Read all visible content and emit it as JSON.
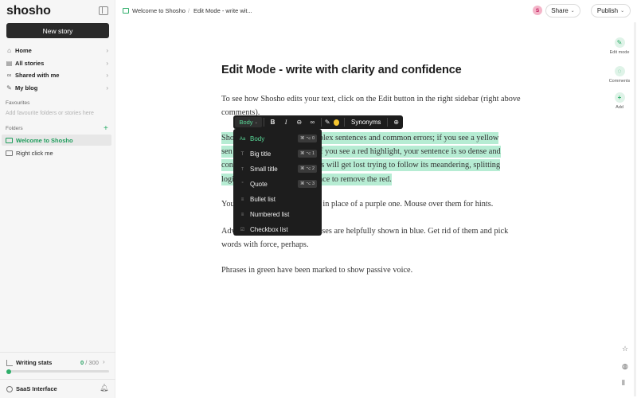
{
  "sidebar": {
    "logo": "shosho",
    "new_story": "New story",
    "nav": [
      {
        "label": "Home",
        "icon": "home-icon"
      },
      {
        "label": "All stories",
        "icon": "stories-icon"
      },
      {
        "label": "Shared with me",
        "icon": "link-icon"
      },
      {
        "label": "My blog",
        "icon": "pen-icon"
      }
    ],
    "favourites_label": "Favourites",
    "favourites_placeholder": "Add favourite folders or stories here",
    "folders_label": "Folders",
    "folders": [
      {
        "label": "Welcome to Shosho",
        "active": true
      },
      {
        "label": "Right click me",
        "active": false
      }
    ],
    "stats": {
      "label": "Writing stats",
      "count": "0",
      "total": "/ 300",
      "progress": 0.0
    },
    "workspace": "SaaS Interface"
  },
  "topbar": {
    "breadcrumb": [
      "Welcome to Shosho",
      "Edit Mode - write wit..."
    ],
    "avatar_letter": "S",
    "share_label": "Share",
    "publish_label": "Publish"
  },
  "rail": [
    {
      "label": "Edit mode",
      "icon": "edit-icon"
    },
    {
      "label": "Comments",
      "icon": "comment-icon"
    },
    {
      "label": "Add",
      "icon": "plus-icon"
    }
  ],
  "document": {
    "title": "Edit Mode -  write with clarity and confidence",
    "p1": "To see how Shosho edits your text, click on the Edit button in the right sidebar (right above comments).",
    "p2_line1_a": "Sho",
    "p2_line1_b": "complex sentences and common errors; if you see a yellow",
    "p2_line2_a": "sen",
    "p2_line2_b": "If you see a red highlight, your sentence is so dense and",
    "p2_line3_a": "con",
    "p2_line3_b": "rs will get lost trying to follow its meandering, splitting",
    "p2_line4_a": "logi",
    "p2_line4_b": "nce to remove the red.",
    "p3_a": "You",
    "p3_b": "d in place of a purple one. Mouse over them for hints.",
    "p4_a": "Adv",
    "p4_b": "ases are helpfully shown in blue. Get rid of them and pick",
    "p4_line2": "words with force, perhaps.",
    "p5": "Phrases in green have been marked to show passive voice."
  },
  "toolbar": {
    "style_label": "Body",
    "buttons": [
      "B",
      "I",
      "S",
      "link"
    ],
    "synonyms_label": "Synonyms",
    "highlight_color": "#f6c630"
  },
  "dropdown": [
    {
      "label": "Body",
      "icon": "Aa",
      "kbd": "⌘ ⌥ 0",
      "selected": true
    },
    {
      "label": "Big title",
      "icon": "T",
      "kbd": "⌘ ⌥ 1",
      "selected": false
    },
    {
      "label": "Small title",
      "icon": "T",
      "kbd": "⌘ ⌥ 2",
      "selected": false
    },
    {
      "label": "Quote",
      "icon": "”",
      "kbd": "⌘ ⌥ 3",
      "selected": false
    },
    {
      "label": "Bullet list",
      "icon": "≡",
      "kbd": "",
      "selected": false
    },
    {
      "label": "Numbered list",
      "icon": "≡",
      "kbd": "",
      "selected": false
    },
    {
      "label": "Checkbox list",
      "icon": "☑",
      "kbd": "",
      "selected": false
    }
  ],
  "colors": {
    "accent": "#2fae6a",
    "highlight": "#b6ecd3",
    "dark": "#1d1d1d"
  }
}
